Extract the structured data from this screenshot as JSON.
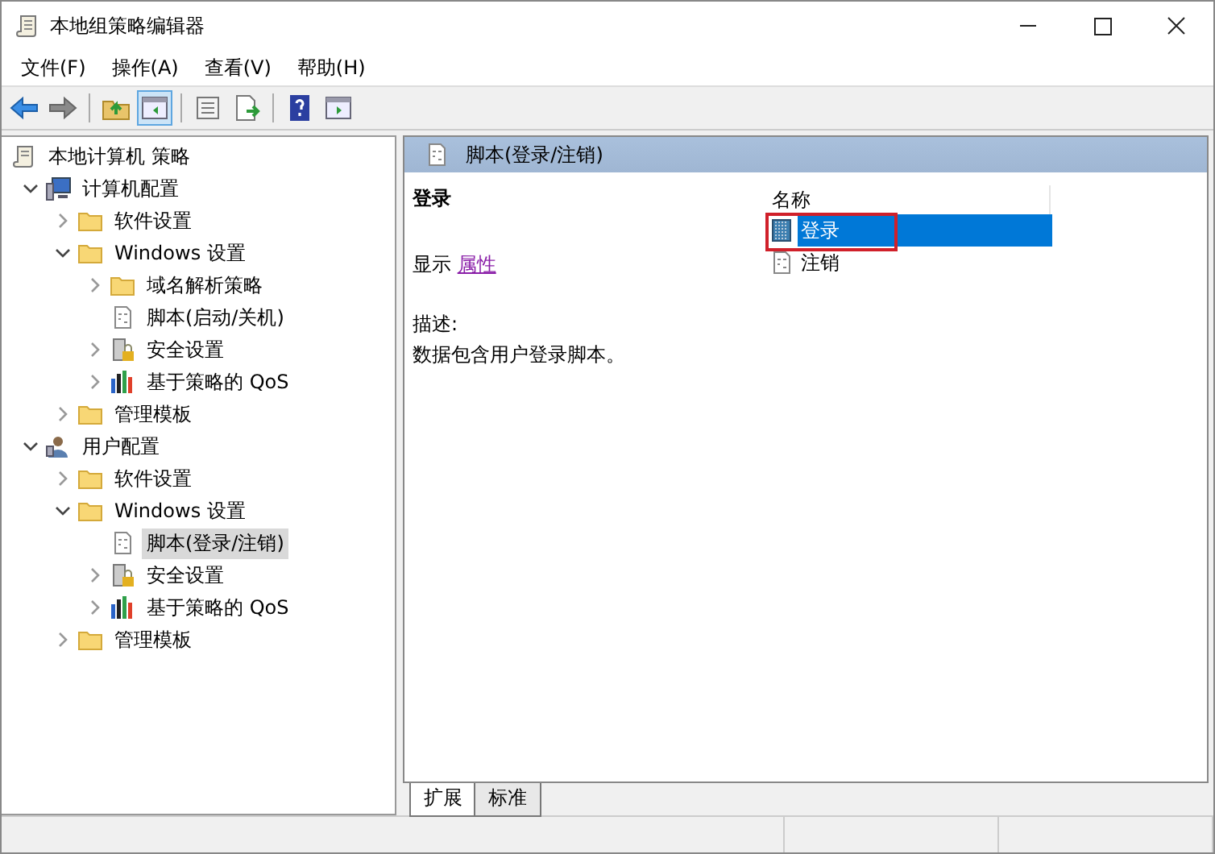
{
  "window": {
    "title": "本地组策略编辑器"
  },
  "menu": [
    "文件(F)",
    "操作(A)",
    "查看(V)",
    "帮助(H)"
  ],
  "toolbar": [
    {
      "kind": "back"
    },
    {
      "kind": "forward"
    },
    {
      "kind": "sep"
    },
    {
      "kind": "up"
    },
    {
      "kind": "tree",
      "pressed": true
    },
    {
      "kind": "sep"
    },
    {
      "kind": "props"
    },
    {
      "kind": "export"
    },
    {
      "kind": "sep"
    },
    {
      "kind": "help"
    },
    {
      "kind": "pane",
      "pressed": false
    }
  ],
  "tree": [
    {
      "label": "本地计算机 策略",
      "kind": "scroll",
      "selected": false,
      "children": [
        {
          "label": "计算机配置",
          "kind": "computer",
          "expanded": true,
          "selected": false,
          "children": [
            {
              "label": "软件设置",
              "kind": "folder",
              "expanded": false,
              "selected": false
            },
            {
              "label": "Windows 设置",
              "kind": "folder",
              "expanded": true,
              "selected": false,
              "children": [
                {
                  "label": "域名解析策略",
                  "kind": "folder",
                  "expanded": false,
                  "selected": false
                },
                {
                  "label": "脚本(启动/关机)",
                  "kind": "script",
                  "selected": false
                },
                {
                  "label": "安全设置",
                  "kind": "security",
                  "expanded": false,
                  "selected": false
                },
                {
                  "label": "基于策略的 QoS",
                  "kind": "chart",
                  "expanded": false,
                  "selected": false
                }
              ]
            },
            {
              "label": "管理模板",
              "kind": "folder",
              "expanded": false,
              "selected": false
            }
          ]
        },
        {
          "label": "用户配置",
          "kind": "user",
          "expanded": true,
          "selected": false,
          "children": [
            {
              "label": "软件设置",
              "kind": "folder",
              "expanded": false,
              "selected": false
            },
            {
              "label": "Windows 设置",
              "kind": "folder",
              "expanded": true,
              "selected": false,
              "children": [
                {
                  "label": "脚本(登录/注销)",
                  "kind": "script",
                  "selected": true
                },
                {
                  "label": "安全设置",
                  "kind": "security",
                  "expanded": false,
                  "selected": false
                },
                {
                  "label": "基于策略的 QoS",
                  "kind": "chart",
                  "expanded": false,
                  "selected": false
                }
              ]
            },
            {
              "label": "管理模板",
              "kind": "folder",
              "expanded": false,
              "selected": false
            }
          ]
        }
      ]
    }
  ],
  "details": {
    "header": "脚本(登录/注销)",
    "heading": "登录",
    "show_label": "显示",
    "show_link": "属性",
    "description_label": "描述:",
    "description": "数据包含用户登录脚本。"
  },
  "list": {
    "column": "名称",
    "items": [
      {
        "label": "登录",
        "kind": "script-selected",
        "selected": true,
        "highlighted": true
      },
      {
        "label": "注销",
        "kind": "script",
        "selected": false,
        "highlighted": false
      }
    ]
  },
  "view_tabs": [
    {
      "label": "扩展",
      "selected": true
    },
    {
      "label": "标准",
      "selected": false
    }
  ]
}
